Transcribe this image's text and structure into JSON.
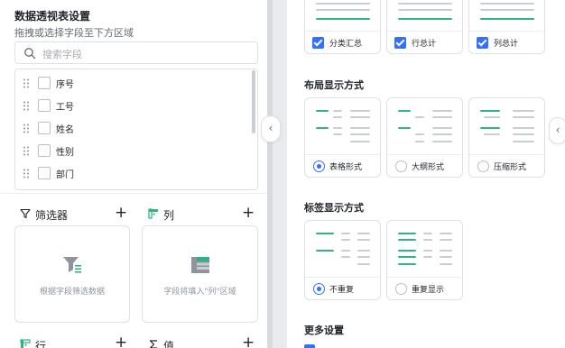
{
  "left_panel": {
    "title": "数据透视表设置",
    "subtitle": "拖拽或选择字段至下方区域",
    "search_placeholder": "搜索字段",
    "fields": [
      {
        "label": "序号",
        "checked": false
      },
      {
        "label": "工号",
        "checked": false
      },
      {
        "label": "姓名",
        "checked": false
      },
      {
        "label": "性别",
        "checked": false
      },
      {
        "label": "部门",
        "checked": false
      }
    ],
    "zones": {
      "filter": {
        "label": "筛选器",
        "hint": "根据字段筛选数据",
        "icon": "filter-icon"
      },
      "column": {
        "label": "列",
        "hint": "字段将填入\"列\"区域",
        "icon": "column-icon"
      },
      "row": {
        "label": "行",
        "icon": "row-icon"
      },
      "value": {
        "label": "值",
        "icon": "sigma-icon"
      }
    },
    "add_symbol": "+"
  },
  "collapse_glyph": "‹",
  "right_panel": {
    "totals": [
      {
        "label": "分类汇总",
        "checked": true
      },
      {
        "label": "行总计",
        "checked": true
      },
      {
        "label": "列总计",
        "checked": true
      }
    ],
    "layout_section": {
      "title": "布局显示方式",
      "options": [
        {
          "label": "表格形式",
          "selected": true
        },
        {
          "label": "大纲形式",
          "selected": false
        },
        {
          "label": "压缩形式",
          "selected": false
        }
      ]
    },
    "label_section": {
      "title": "标签显示方式",
      "options": [
        {
          "label": "不重复",
          "selected": true
        },
        {
          "label": "重复显示",
          "selected": false
        }
      ]
    },
    "more_settings": {
      "title": "更多设置"
    }
  },
  "colors": {
    "accent": "#3370ff",
    "green": "#2fb37f",
    "gray_line": "#c9cdd4",
    "border": "#dee0e3"
  }
}
